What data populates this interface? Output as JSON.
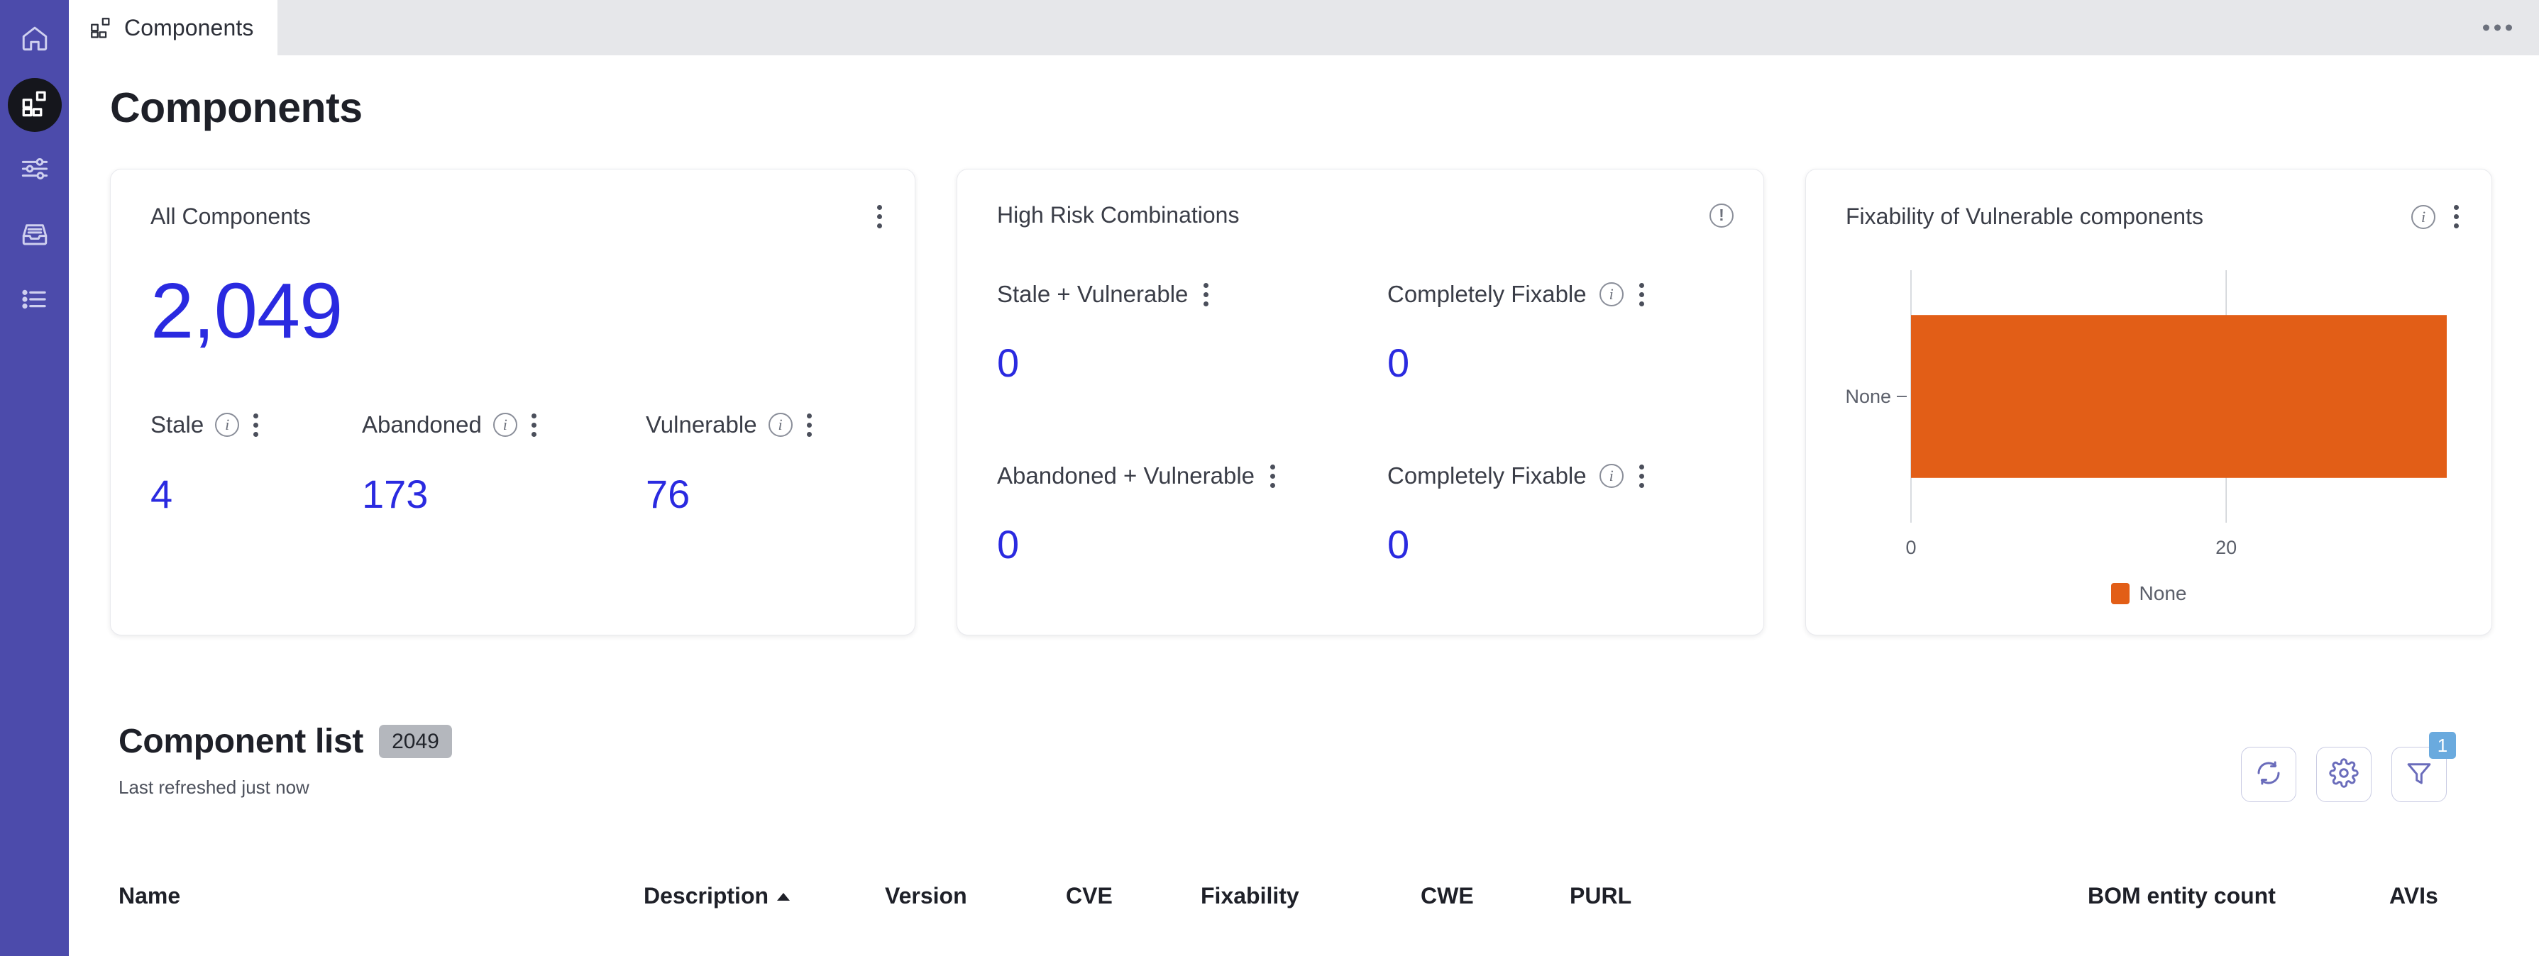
{
  "sidebar": {
    "items": [
      {
        "name": "home",
        "icon": "home-icon",
        "active": false
      },
      {
        "name": "components",
        "icon": "components-grid-icon",
        "active": true
      },
      {
        "name": "settings",
        "icon": "sliders-icon",
        "active": false
      },
      {
        "name": "inbox",
        "icon": "inbox-icon",
        "active": false
      },
      {
        "name": "list",
        "icon": "list-icon",
        "active": false
      }
    ]
  },
  "tabbar": {
    "active_tab": "Components",
    "tab_icon": "components-grid-icon",
    "overflow_icon": "ellipsis-icon"
  },
  "page": {
    "title": "Components"
  },
  "cards": {
    "all_components": {
      "title": "All Components",
      "menu_icon": "kebab-menu-icon",
      "total": "2,049",
      "metrics": [
        {
          "label": "Stale",
          "value": "4",
          "info_icon": "info-icon",
          "menu_icon": "kebab-menu-icon"
        },
        {
          "label": "Abandoned",
          "value": "173",
          "info_icon": "info-icon",
          "menu_icon": "kebab-menu-icon"
        },
        {
          "label": "Vulnerable",
          "value": "76",
          "info_icon": "info-icon",
          "menu_icon": "kebab-menu-icon"
        }
      ]
    },
    "high_risk": {
      "title": "High Risk Combinations",
      "alert_icon": "alert-circle-icon",
      "cells": [
        {
          "label": "Stale + Vulnerable",
          "value": "0",
          "has_info": false,
          "menu_icon": "kebab-menu-icon"
        },
        {
          "label": "Completely Fixable",
          "value": "0",
          "has_info": true,
          "info_icon": "info-icon",
          "menu_icon": "kebab-menu-icon"
        },
        {
          "label": "Abandoned + Vulnerable",
          "value": "0",
          "has_info": false,
          "menu_icon": "kebab-menu-icon"
        },
        {
          "label": "Completely Fixable",
          "value": "0",
          "has_info": true,
          "info_icon": "info-icon",
          "menu_icon": "kebab-menu-icon"
        }
      ]
    },
    "fixability": {
      "title": "Fixability of Vulnerable components",
      "info_icon": "info-icon",
      "menu_icon": "kebab-menu-icon",
      "bar_color": "#e25e17"
    }
  },
  "chart_data": {
    "type": "bar",
    "orientation": "horizontal",
    "title": "Fixability of Vulnerable components",
    "categories": [
      "None"
    ],
    "values": [
      34
    ],
    "series": [
      {
        "name": "None",
        "values": [
          34
        ],
        "color": "#e25e17"
      }
    ],
    "xlabel": "",
    "ylabel": "",
    "xticks": [
      0,
      20
    ],
    "xtick_labels": [
      "0",
      "20"
    ],
    "xlim": [
      0,
      34
    ],
    "grid": true,
    "legend": {
      "position": "bottom",
      "entries": [
        {
          "label": "None",
          "color": "#e25e17"
        }
      ]
    }
  },
  "component_list": {
    "title": "Component list",
    "count": "2049",
    "last_refreshed": "Last refreshed just now",
    "tools": [
      {
        "name": "refresh-button",
        "icon": "refresh-icon"
      },
      {
        "name": "settings-button",
        "icon": "gear-icon"
      },
      {
        "name": "filter-button",
        "icon": "filter-icon",
        "badge": "1"
      }
    ],
    "columns": [
      {
        "label": "Name",
        "sort": null
      },
      {
        "label": "Description",
        "sort": "asc"
      },
      {
        "label": "Version",
        "sort": null
      },
      {
        "label": "CVE",
        "sort": null
      },
      {
        "label": "Fixability",
        "sort": null
      },
      {
        "label": "CWE",
        "sort": null
      },
      {
        "label": "PURL",
        "sort": null
      },
      {
        "label": "BOM entity count",
        "sort": null
      },
      {
        "label": "AVIs",
        "sort": null
      }
    ]
  },
  "colors": {
    "rail": "#4c4bab",
    "accent_number": "#2a2ae0",
    "bar": "#e25e17",
    "badge": "#6aaade",
    "tabstrip": "#e6e7ea"
  }
}
